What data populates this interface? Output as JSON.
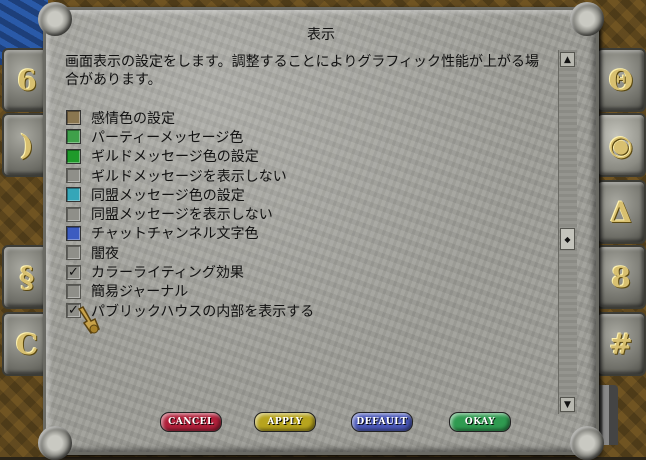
{
  "dialog": {
    "title": "表示",
    "description": "画面表示の設定をします。調整することによりグラフィック性能が上がる場合があります。"
  },
  "options": [
    {
      "label": "感情色の設定",
      "type": "swatch",
      "color": "#8a7650",
      "checked": false
    },
    {
      "label": "パーティーメッセージ色",
      "type": "swatch",
      "color": "#3fa04a",
      "checked": false
    },
    {
      "label": "ギルドメッセージ色の設定",
      "type": "swatch",
      "color": "#1f9a2a",
      "checked": false
    },
    {
      "label": "ギルドメッセージを表示しない",
      "type": "checkbox",
      "checked": false
    },
    {
      "label": "同盟メッセージ色の設定",
      "type": "swatch",
      "color": "#35a6b8",
      "checked": false
    },
    {
      "label": "同盟メッセージを表示しない",
      "type": "checkbox",
      "checked": false
    },
    {
      "label": "チャットチャンネル文字色",
      "type": "swatch",
      "color": "#3c5cc0",
      "checked": false
    },
    {
      "label": "闇夜",
      "type": "checkbox",
      "checked": false
    },
    {
      "label": "カラーライティング効果",
      "type": "checkbox",
      "checked": true
    },
    {
      "label": "簡易ジャーナル",
      "type": "checkbox",
      "checked": false
    },
    {
      "label": "パブリックハウスの内部を表示する",
      "type": "checkbox",
      "checked": true
    }
  ],
  "buttons": {
    "cancel": "CANCEL",
    "apply": "APPLY",
    "default": "DEFAULT",
    "okay": "OKAY"
  },
  "check_mark": "✓",
  "side_icons": {
    "left": [
      "rune-6-icon",
      "rune-crescent-icon",
      "rune-scroll-icon",
      "rune-face-icon",
      "rune-moon-icon"
    ],
    "right": [
      "rune-shield-icon",
      "rune-eye-icon",
      "rune-triangle-icon",
      "rune-8-icon",
      "rune-grid-icon"
    ]
  },
  "colors": {
    "dialog_stone": "#9d9d97",
    "rune_gold": "#d8c070"
  }
}
